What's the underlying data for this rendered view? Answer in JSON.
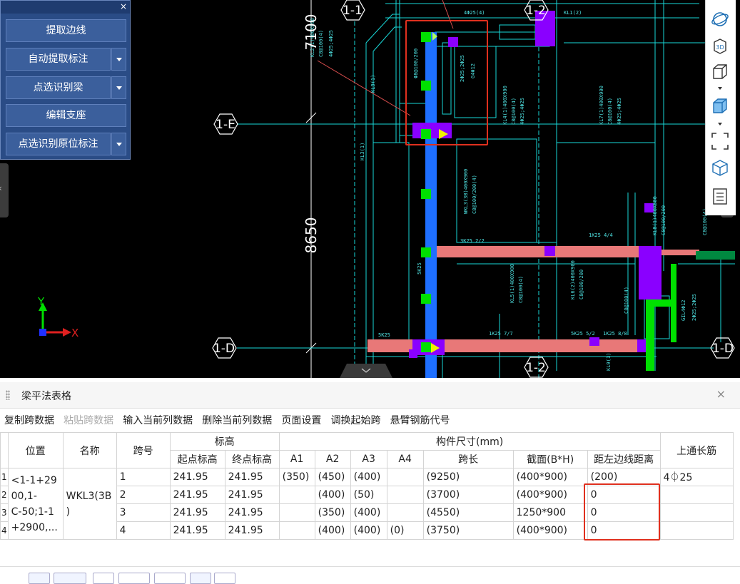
{
  "panel": {
    "close": "×",
    "buttons": [
      {
        "label": "提取边线",
        "has_dropdown": false
      },
      {
        "label": "自动提取标注",
        "has_dropdown": true
      },
      {
        "label": "点选识别梁",
        "has_dropdown": true
      },
      {
        "label": "编辑支座",
        "has_dropdown": false
      },
      {
        "label": "点选识别原位标注",
        "has_dropdown": true
      }
    ]
  },
  "cad": {
    "axis_labels": {
      "e": "1-E",
      "d": "1-D",
      "d_right": "1-D",
      "top_left": "1-1",
      "top_mid": "1-2",
      "bottom_mid": "1-2"
    },
    "dimensions": {
      "upper": "7100",
      "lower": "8650"
    },
    "ucs": {
      "y": "Y",
      "x": "X"
    },
    "colors": {
      "background": "#000000",
      "grid": "#18d8d8",
      "beam_selected": "#1e6fff",
      "beam_pink": "#e87878",
      "support": "#00e000",
      "column": "#8a00ff",
      "highlight": "#e0301e"
    }
  },
  "toolbar_right": {
    "icons": [
      "orbit-icon",
      "view-3d-icon",
      "cube-icon",
      "cube-solid-icon",
      "fullscreen-icon",
      "cube-outline-icon",
      "list-icon"
    ],
    "label_3d": "3D"
  },
  "table_panel": {
    "title": "梁平法表格",
    "close": "×",
    "toolbar": {
      "copy_span": "复制跨数据",
      "paste_span": "粘贴跨数据",
      "input_column": "输入当前列数据",
      "delete_column": "删除当前列数据",
      "page_setup": "页面设置",
      "swap_start": "调换起始跨",
      "cantilever": "悬臂钢筋代号"
    },
    "headers": {
      "position": "位置",
      "name": "名称",
      "span_no": "跨号",
      "elevation": "标高",
      "start_elev": "起点标高",
      "end_elev": "终点标高",
      "dims": "构件尺寸(mm)",
      "a1": "A1",
      "a2": "A2",
      "a3": "A3",
      "a4": "A4",
      "span_len": "跨长",
      "section": "截面(B*H)",
      "offset": "距左边线距离",
      "top_bar": "上通长筋"
    },
    "position_text": "<1-1+2900,1-C-50;1-1+2900,...",
    "position_lines": [
      "<1-1+29",
      "00,1-",
      "C-50;1-1",
      "+2900,..."
    ],
    "name_lines": [
      "WKL3(3B",
      ")"
    ],
    "row_numbers": [
      "1",
      "2",
      "3",
      "4"
    ],
    "rows": [
      {
        "span": "1",
        "start": "241.95",
        "end": "241.95",
        "a1": "(350)",
        "a2": "(450)",
        "a3": "(400)",
        "a4": "",
        "len": "(9250)",
        "section": "(400*900)",
        "offset": "(200)",
        "top_bar": "4⏀25"
      },
      {
        "span": "2",
        "start": "241.95",
        "end": "241.95",
        "a1": "",
        "a2": "(400)",
        "a3": "(50)",
        "a4": "",
        "len": "(3700)",
        "section": "(400*900)",
        "offset": "0",
        "top_bar": ""
      },
      {
        "span": "3",
        "start": "241.95",
        "end": "241.95",
        "a1": "",
        "a2": "(350)",
        "a3": "(400)",
        "a4": "",
        "len": "(4550)",
        "section": "1250*900",
        "offset": "0",
        "top_bar": ""
      },
      {
        "span": "4",
        "start": "241.95",
        "end": "241.95",
        "a1": "",
        "a2": "(400)",
        "a3": "(400)",
        "a4": "(0)",
        "len": "(3750)",
        "section": "(400*900)",
        "offset": "0",
        "top_bar": ""
      }
    ]
  }
}
